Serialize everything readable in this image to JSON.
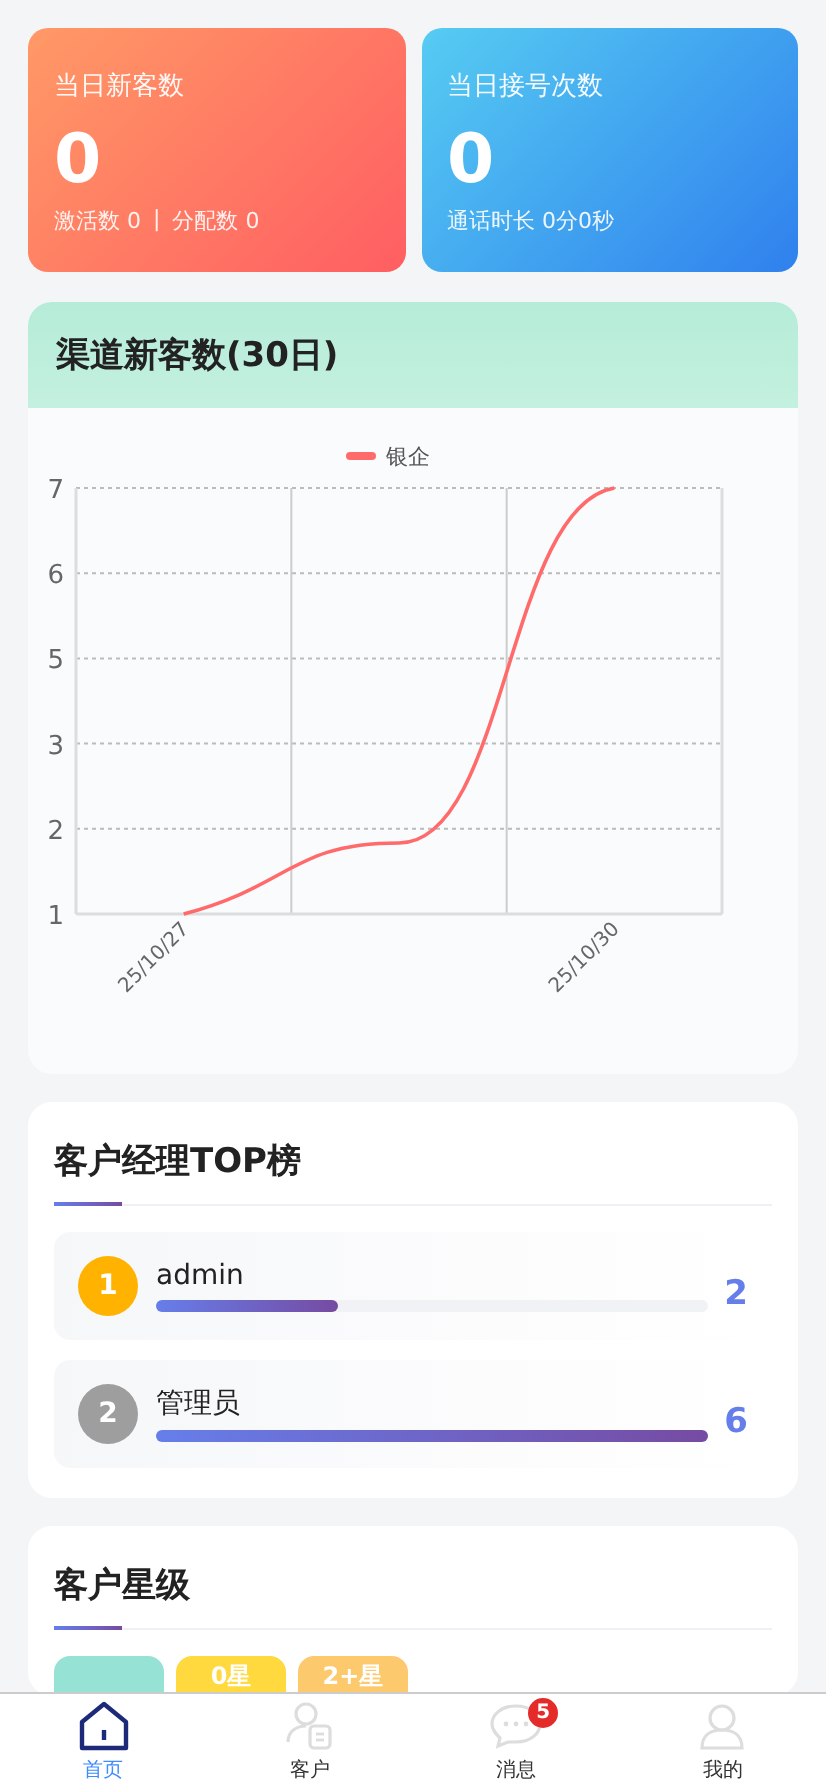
{
  "stat_cards": [
    {
      "kind": "warm",
      "title": "当日新客数",
      "value": "0",
      "subs": [
        "激活数 0",
        "|",
        "分配数 0"
      ]
    },
    {
      "kind": "cool",
      "title": "当日接号次数",
      "value": "0",
      "subs": [
        "通话时长 0分0秒"
      ]
    }
  ],
  "channel_panel": {
    "title": "渠道新客数(30日)",
    "chart_data": {
      "type": "line",
      "categories": [
        "25/10/27",
        null,
        "25/10/30"
      ],
      "yticks": [
        {
          "value": 1,
          "label": "1"
        },
        {
          "value": 2.2,
          "label": "2"
        },
        {
          "value": 3.4,
          "label": "3"
        },
        {
          "value": 4.6,
          "label": "5"
        },
        {
          "value": 5.8,
          "label": "6"
        },
        {
          "value": 7,
          "label": "7"
        }
      ],
      "ylim": [
        1,
        7
      ],
      "grid": true,
      "series": [
        {
          "name": "银企",
          "color": "#ff6b6b",
          "values": [
            1,
            2,
            7
          ]
        }
      ]
    }
  },
  "top_panel": {
    "title": "客户经理TOP榜",
    "rows": [
      {
        "rank": "1",
        "color": "#ffb300",
        "name": "admin",
        "level": 0.33,
        "count": "2"
      },
      {
        "rank": "2",
        "color": "#9e9e9e",
        "name": "管理员",
        "level": 1,
        "count": "6"
      }
    ]
  },
  "star_panel": {
    "title": "客户星级",
    "tiles": [
      {
        "color": "#96e2d4"
      },
      {
        "color": "#ffd93d",
        "label": "0星"
      },
      {
        "color": "#fdc96d",
        "label": "2+星"
      }
    ]
  },
  "tab_bar": [
    {
      "kind": "home",
      "label": "首页",
      "selected": true
    },
    {
      "kind": "customer",
      "label": "客户",
      "selected": false
    },
    {
      "kind": "message",
      "label": "消息",
      "selected": false,
      "badge": "5"
    },
    {
      "kind": "me",
      "label": "我的",
      "selected": false
    }
  ]
}
